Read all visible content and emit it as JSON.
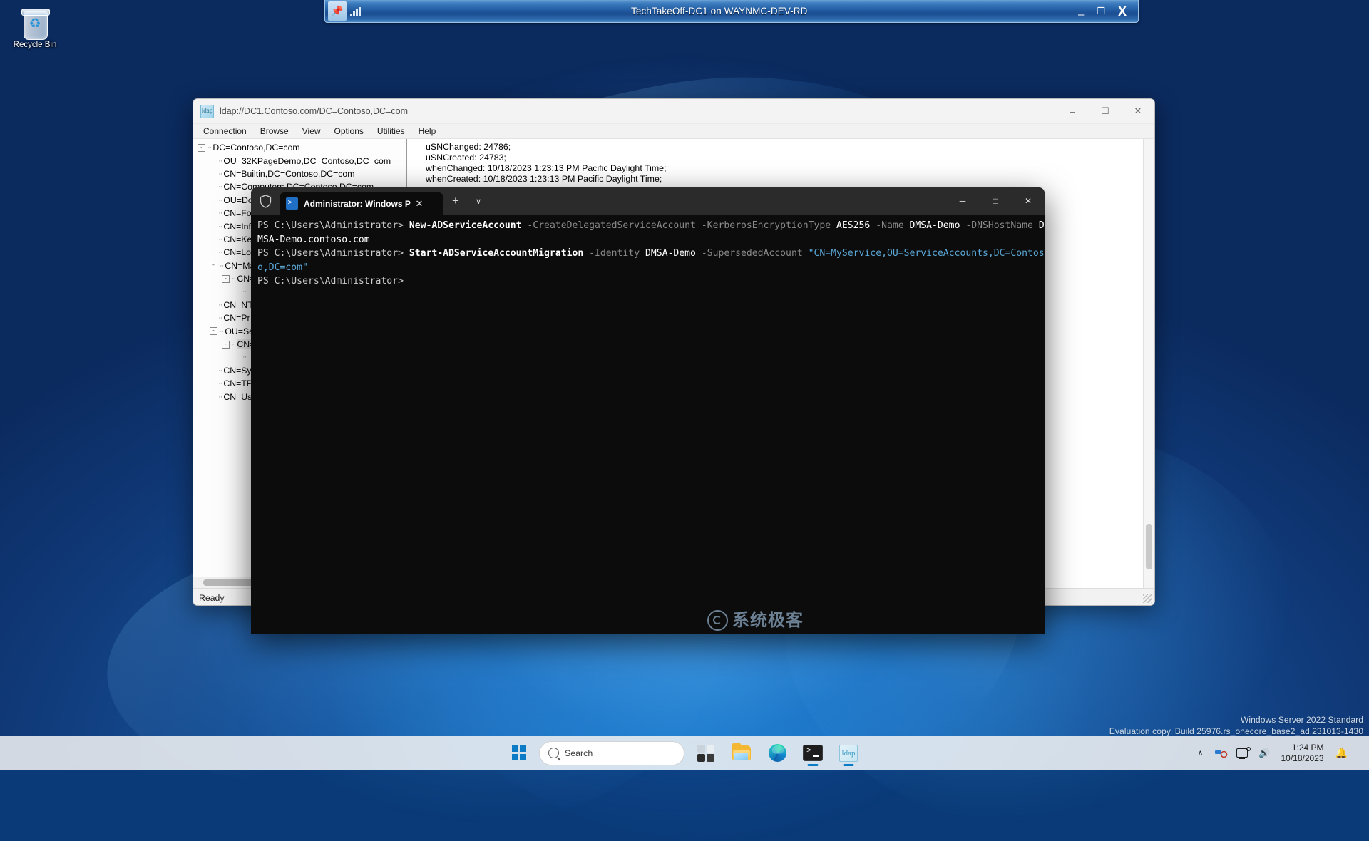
{
  "desktop": {
    "recycle_bin_label": "Recycle Bin",
    "eval_watermark_line1": "Windows Server 2022 Standard",
    "eval_watermark_line2": "Evaluation copy. Build 25976.rs_onecore_base2_ad.231013-1430"
  },
  "rdp_bar": {
    "title": "TechTakeOff-DC1 on WAYNMC-DEV-RD",
    "pin_icon": "pin-icon",
    "signal_icon": "signal-strength-icon",
    "minimize": "–",
    "restore": "❐",
    "close": "X"
  },
  "ldp_window": {
    "title": "ldap://DC1.Contoso.com/DC=Contoso,DC=com",
    "icon": "ldp-app-icon",
    "controls": {
      "minimize": "–",
      "maximize": "☐",
      "close": "✕"
    },
    "menu": [
      "Connection",
      "Browse",
      "View",
      "Options",
      "Utilities",
      "Help"
    ],
    "tree": [
      {
        "level": 1,
        "expander": "-",
        "label": "DC=Contoso,DC=com"
      },
      {
        "level": 2,
        "expander": "",
        "label": "OU=32KPageDemo,DC=Contoso,DC=com"
      },
      {
        "level": 2,
        "expander": "",
        "label": "CN=Builtin,DC=Contoso,DC=com"
      },
      {
        "level": 2,
        "expander": "",
        "label": "CN=Computers,DC=Contoso,DC=com"
      },
      {
        "level": 2,
        "expander": "",
        "label": "OU=Do"
      },
      {
        "level": 2,
        "expander": "",
        "label": "CN=Fo"
      },
      {
        "level": 2,
        "expander": "",
        "label": "CN=Inf"
      },
      {
        "level": 2,
        "expander": "",
        "label": "CN=Ke"
      },
      {
        "level": 2,
        "expander": "",
        "label": "CN=Lo"
      },
      {
        "level": 2,
        "expander": "-",
        "label": "CN=Ma"
      },
      {
        "level": 3,
        "expander": "-",
        "label": "CN="
      },
      {
        "level": 4,
        "expander": "",
        "label": ""
      },
      {
        "level": 2,
        "expander": "",
        "label": "CN=NT"
      },
      {
        "level": 2,
        "expander": "",
        "label": "CN=Pr"
      },
      {
        "level": 2,
        "expander": "-",
        "label": "OU=Se"
      },
      {
        "level": 3,
        "expander": "-",
        "label": "CN="
      },
      {
        "level": 4,
        "expander": "",
        "label": ""
      },
      {
        "level": 2,
        "expander": "",
        "label": "CN=Sy"
      },
      {
        "level": 2,
        "expander": "",
        "label": "CN=TP"
      },
      {
        "level": 2,
        "expander": "",
        "label": "CN=Us"
      }
    ],
    "attributes": [
      "uSNChanged: 24786;",
      "uSNCreated: 24783;",
      "whenChanged: 10/18/2023 1:23:13 PM Pacific Daylight Time;",
      "whenCreated: 10/18/2023 1:23:13 PM Pacific Daylight Time;"
    ],
    "status": "Ready"
  },
  "terminal": {
    "shield_icon": "shield-icon",
    "tab_icon": "powershell-icon",
    "tab_title": "Administrator: Windows Powe",
    "tab_close": "✕",
    "new_tab": "+",
    "dropdown": "∨",
    "controls": {
      "minimize": "─",
      "maximize": "□",
      "close": "✕"
    },
    "watermark": "系统极客",
    "lines": [
      {
        "segments": [
          {
            "text": "PS C:\\Users\\Administrator> ",
            "style": "prompt"
          },
          {
            "text": "New-ADServiceAccount ",
            "style": "cmd"
          },
          {
            "text": "-CreateDelegatedServiceAccount ",
            "style": "param"
          },
          {
            "text": "-KerberosEncryptionType ",
            "style": "param"
          },
          {
            "text": "AES256 ",
            "style": "plain"
          },
          {
            "text": "-Name ",
            "style": "param"
          },
          {
            "text": "DMSA-Demo ",
            "style": "plain"
          },
          {
            "text": "-DNSHostName ",
            "style": "param"
          },
          {
            "text": "DMSA-Demo.contoso.com",
            "style": "plain"
          }
        ]
      },
      {
        "segments": [
          {
            "text": "PS C:\\Users\\Administrator> ",
            "style": "prompt"
          },
          {
            "text": "Start-ADServiceAccountMigration ",
            "style": "cmd"
          },
          {
            "text": "-Identity ",
            "style": "param"
          },
          {
            "text": "DMSA-Demo ",
            "style": "plain"
          },
          {
            "text": "-SupersededAccount ",
            "style": "param"
          },
          {
            "text": "\"CN=MyService,OU=ServiceAccounts,DC=Contoso,DC=com\"",
            "style": "string"
          }
        ]
      },
      {
        "segments": [
          {
            "text": "PS C:\\Users\\Administrator>",
            "style": "prompt"
          }
        ]
      }
    ]
  },
  "taskbar": {
    "start_icon": "windows-start-icon",
    "search_placeholder": "Search",
    "search_icon": "search-icon",
    "apps": [
      {
        "name": "widgets-icon",
        "type": "widgets"
      },
      {
        "name": "file-explorer-icon",
        "type": "folder"
      },
      {
        "name": "microsoft-edge-icon",
        "type": "edge"
      },
      {
        "name": "windows-terminal-icon",
        "type": "terminal",
        "active": true
      },
      {
        "name": "ldp-icon",
        "type": "ldp",
        "active": true
      }
    ],
    "tray": {
      "chevron": "∧",
      "network_tool_icon": "network-tool-icon",
      "network_icon": "network-icon",
      "volume_icon": "🔊",
      "time": "1:24 PM",
      "date": "10/18/2023",
      "bell_icon": "🔔"
    }
  }
}
